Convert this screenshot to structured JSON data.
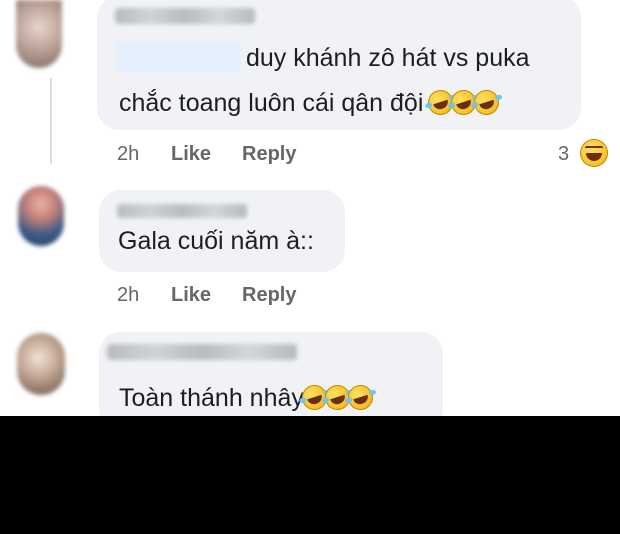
{
  "comments": [
    {
      "text_line1": "duy khánh zô hát vs puka",
      "text_line2": "chắc toang luôn cái qân đội",
      "emojis": [
        "rolling-on-floor-laughing",
        "rolling-on-floor-laughing",
        "rolling-on-floor-laughing"
      ],
      "time": "2h",
      "like_label": "Like",
      "reply_label": "Reply",
      "reaction_count": "3",
      "reaction_icon": "laughing-face"
    },
    {
      "text": "Gala cuối năm à::",
      "time": "2h",
      "like_label": "Like",
      "reply_label": "Reply"
    },
    {
      "text": "Toàn thánh nhây",
      "emojis": [
        "rolling-on-floor-laughing",
        "rolling-on-floor-laughing",
        "rolling-on-floor-laughing"
      ]
    }
  ],
  "colors": {
    "bubble": "#f0f2f5",
    "meta_text": "#65676b",
    "body_text": "#1c1e21",
    "bottom_bar": "#000000"
  }
}
